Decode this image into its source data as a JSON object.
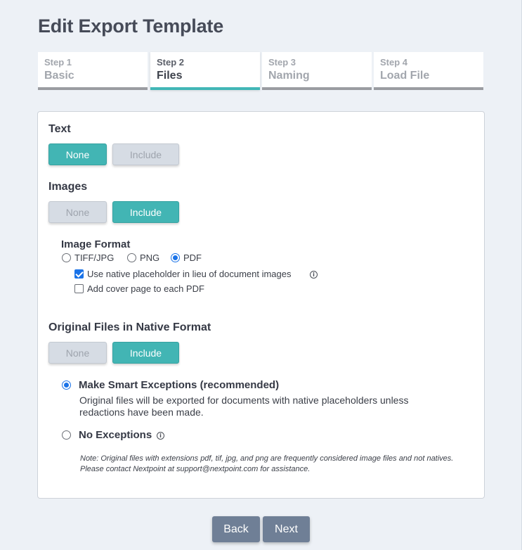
{
  "page": {
    "title": "Edit Export Template"
  },
  "steps": [
    {
      "num": "Step 1",
      "name": "Basic",
      "active": false
    },
    {
      "num": "Step 2",
      "name": "Files",
      "active": true
    },
    {
      "num": "Step 3",
      "name": "Naming",
      "active": false
    },
    {
      "num": "Step 4",
      "name": "Load File",
      "active": false
    }
  ],
  "text_section": {
    "label": "Text",
    "none_label": "None",
    "include_label": "Include",
    "selected": "None"
  },
  "images_section": {
    "label": "Images",
    "none_label": "None",
    "include_label": "Include",
    "selected": "Include",
    "format": {
      "label": "Image Format",
      "options": [
        "TIFF/JPG",
        "PNG",
        "PDF"
      ],
      "selected": "PDF",
      "native_placeholder": {
        "label": "Use native placeholder in lieu of document images",
        "checked": true
      },
      "cover_page": {
        "label": "Add cover page to each PDF",
        "checked": false
      }
    }
  },
  "native_section": {
    "label": "Original Files in Native Format",
    "none_label": "None",
    "include_label": "Include",
    "selected": "Include",
    "smart_exceptions": {
      "title": "Make Smart Exceptions (recommended)",
      "description": "Original files will be exported for documents with native placeholders unless redactions have been made.",
      "selected": true
    },
    "no_exceptions": {
      "title": "No Exceptions",
      "selected": false
    },
    "note": "Note: Original files with extensions pdf, tif, jpg, and png are frequently considered image files and not natives. Please contact Nextpoint at support@nextpoint.com for assistance."
  },
  "footer": {
    "back_label": "Back",
    "next_label": "Next"
  },
  "colors": {
    "accent": "#42b5b4",
    "inactive_button": "#d6dce4",
    "nav_button": "#6f7f96",
    "radio_checked": "#1a73e8"
  },
  "icons": {
    "info": "info-icon"
  }
}
